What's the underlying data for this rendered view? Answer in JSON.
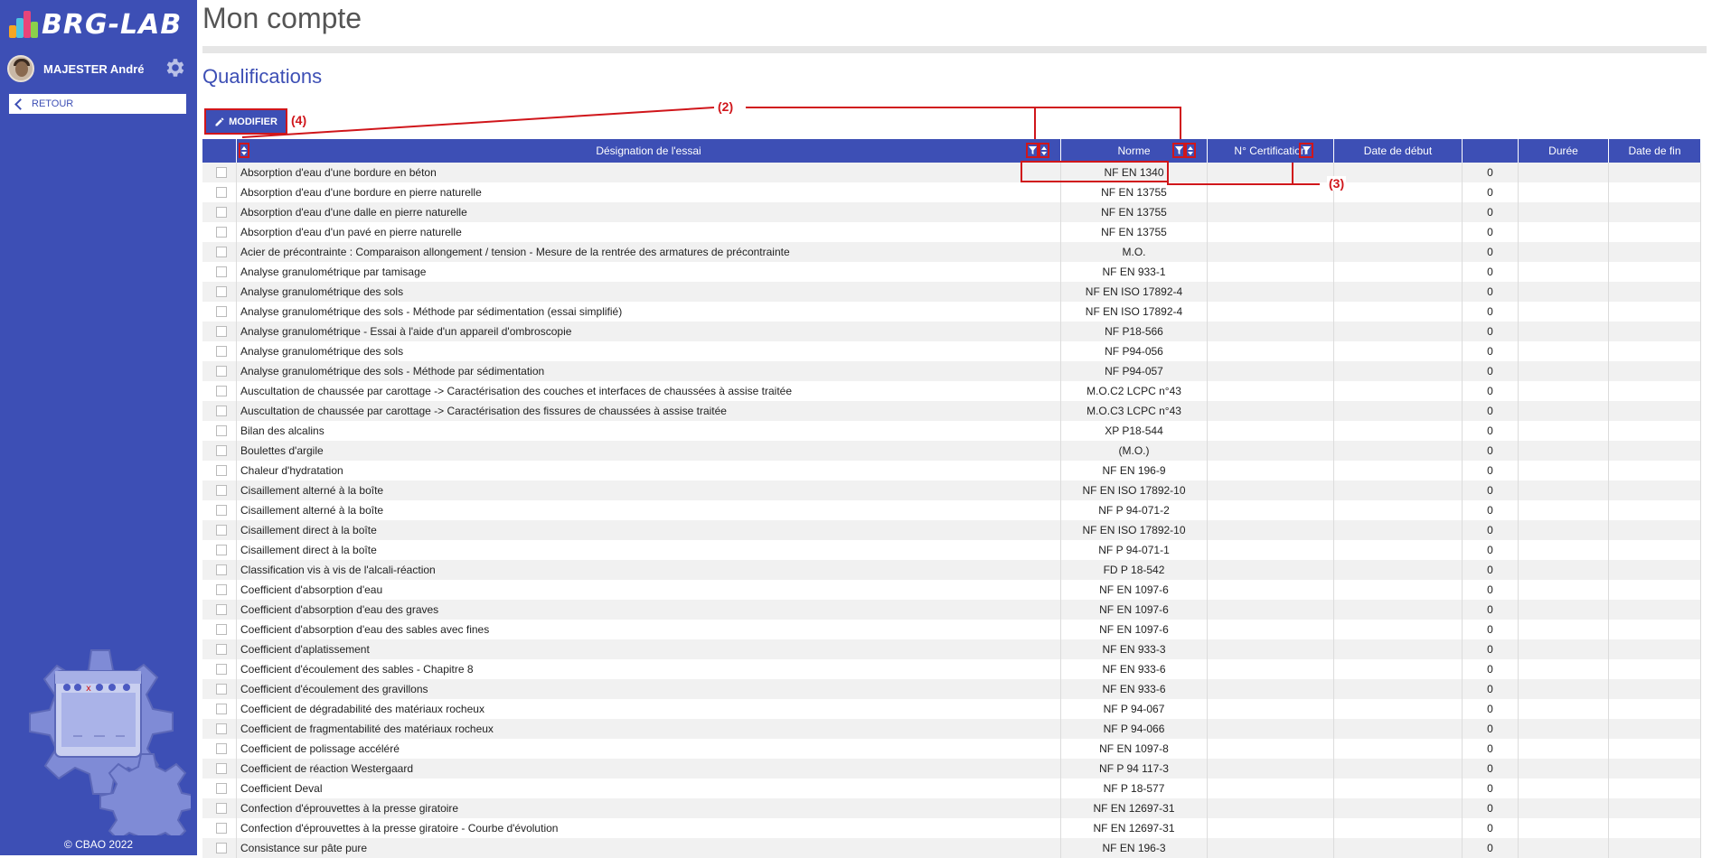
{
  "sidebar": {
    "logo_text": "BRG-LAB",
    "user_name": "MAJESTER André",
    "back_label": "RETOUR",
    "copyright": "© CBAO 2022"
  },
  "main": {
    "page_title": "Mon compte",
    "section_title": "Qualifications",
    "modify_label": "MODIFIER"
  },
  "table": {
    "columns": [
      "Désignation de l'essai",
      "Norme",
      "N° Certification",
      "Date de début",
      "",
      "Durée",
      "Date de fin"
    ],
    "rows": [
      {
        "designation": "Absorption d'eau d'une bordure en béton",
        "norme": "NF EN 1340",
        "value": "0"
      },
      {
        "designation": "Absorption d'eau d'une bordure en pierre naturelle",
        "norme": "NF EN 13755",
        "value": "0"
      },
      {
        "designation": "Absorption d'eau d'une dalle en pierre naturelle",
        "norme": "NF EN 13755",
        "value": "0"
      },
      {
        "designation": "Absorption d'eau d'un pavé en pierre naturelle",
        "norme": "NF EN 13755",
        "value": "0"
      },
      {
        "designation": "Acier de précontrainte : Comparaison allongement / tension - Mesure de la rentrée des armatures de précontrainte",
        "norme": "M.O.",
        "value": "0"
      },
      {
        "designation": "Analyse granulométrique par tamisage",
        "norme": "NF EN 933-1",
        "value": "0"
      },
      {
        "designation": "Analyse granulométrique des sols",
        "norme": "NF EN ISO 17892-4",
        "value": "0"
      },
      {
        "designation": "Analyse granulométrique des sols - Méthode par sédimentation (essai simplifié)",
        "norme": "NF EN ISO 17892-4",
        "value": "0"
      },
      {
        "designation": "Analyse granulométrique - Essai à l'aide d'un appareil d'ombroscopie",
        "norme": "NF P18-566",
        "value": "0"
      },
      {
        "designation": "Analyse granulométrique des sols",
        "norme": "NF P94-056",
        "value": "0"
      },
      {
        "designation": "Analyse granulométrique des sols - Méthode par sédimentation",
        "norme": "NF P94-057",
        "value": "0"
      },
      {
        "designation": "Auscultation de chaussée par carottage -> Caractérisation des couches et interfaces de chaussées à assise traitée",
        "norme": "M.O.C2 LCPC n°43",
        "value": "0"
      },
      {
        "designation": "Auscultation de chaussée par carottage -> Caractérisation des fissures de chaussées à assise traitée",
        "norme": "M.O.C3 LCPC n°43",
        "value": "0"
      },
      {
        "designation": "Bilan des alcalins",
        "norme": "XP P18-544",
        "value": "0"
      },
      {
        "designation": "Boulettes d'argile",
        "norme": "(M.O.)",
        "value": "0"
      },
      {
        "designation": "Chaleur d'hydratation",
        "norme": "NF EN 196-9",
        "value": "0"
      },
      {
        "designation": "Cisaillement alterné à la boîte",
        "norme": "NF EN ISO 17892-10",
        "value": "0"
      },
      {
        "designation": "Cisaillement alterné à la boîte",
        "norme": "NF P 94-071-2",
        "value": "0"
      },
      {
        "designation": "Cisaillement direct à la boîte",
        "norme": "NF EN ISO 17892-10",
        "value": "0"
      },
      {
        "designation": "Cisaillement direct à la boîte",
        "norme": "NF P 94-071-1",
        "value": "0"
      },
      {
        "designation": "Classification vis à vis de l'alcali-réaction",
        "norme": "FD P 18-542",
        "value": "0"
      },
      {
        "designation": "Coefficient d'absorption d'eau",
        "norme": "NF EN 1097-6",
        "value": "0"
      },
      {
        "designation": "Coefficient d'absorption d'eau des graves",
        "norme": "NF EN 1097-6",
        "value": "0"
      },
      {
        "designation": "Coefficient d'absorption d'eau des sables avec fines",
        "norme": "NF EN 1097-6",
        "value": "0"
      },
      {
        "designation": "Coefficient d'aplatissement",
        "norme": "NF EN 933-3",
        "value": "0"
      },
      {
        "designation": "Coefficient d'écoulement des sables - Chapitre 8",
        "norme": "NF EN 933-6",
        "value": "0"
      },
      {
        "designation": "Coefficient d'écoulement des gravillons",
        "norme": "NF EN 933-6",
        "value": "0"
      },
      {
        "designation": "Coefficient de dégradabilité des matériaux rocheux",
        "norme": "NF P 94-067",
        "value": "0"
      },
      {
        "designation": "Coefficient de fragmentabilité des matériaux rocheux",
        "norme": "NF P 94-066",
        "value": "0"
      },
      {
        "designation": "Coefficient de polissage accéléré",
        "norme": "NF EN 1097-8",
        "value": "0"
      },
      {
        "designation": "Coefficient de réaction Westergaard",
        "norme": "NF P 94 117-3",
        "value": "0"
      },
      {
        "designation": "Coefficient Deval",
        "norme": "NF P 18-577",
        "value": "0"
      },
      {
        "designation": "Confection d'éprouvettes à la presse giratoire",
        "norme": "NF EN 12697-31",
        "value": "0"
      },
      {
        "designation": "Confection d'éprouvettes à la presse giratoire - Courbe d'évolution",
        "norme": "NF EN 12697-31",
        "value": "0"
      },
      {
        "designation": "Consistance sur pâte pure",
        "norme": "NF EN 196-3",
        "value": "0"
      }
    ]
  },
  "annotations": {
    "a2": "(2)",
    "a3": "(3)",
    "a4": "(4)"
  },
  "colors": {
    "brand": "#3d4fb5",
    "annotation": "#d0161b"
  },
  "icons": [
    "brg-logo-icon",
    "gear-icon",
    "chevron-left-icon",
    "pencil-icon",
    "filter-icon",
    "sort-icon",
    "checkbox-icon"
  ]
}
